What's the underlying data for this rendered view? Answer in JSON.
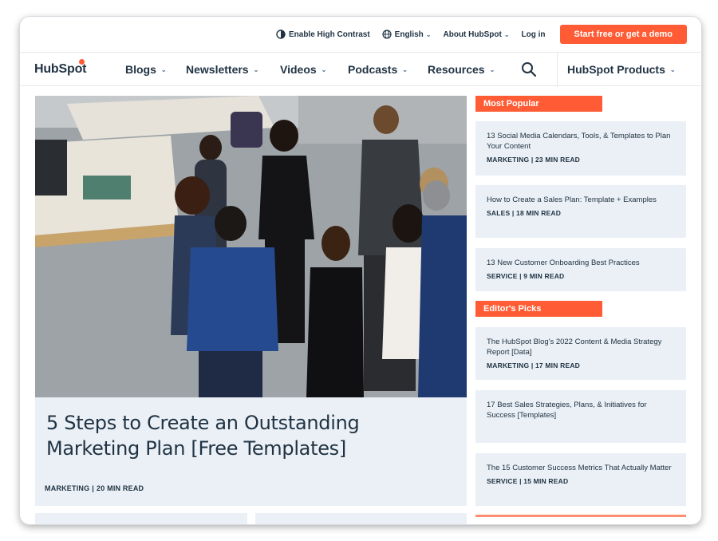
{
  "utility_bar": {
    "contrast_label": "Enable High Contrast",
    "language_label": "English",
    "about_label": "About HubSpot",
    "login_label": "Log in",
    "cta_label": "Start free or get a demo"
  },
  "logo": {
    "text_a": "HubSp",
    "text_o": "o",
    "text_b": "t"
  },
  "nav": {
    "items": [
      {
        "label": "Blogs"
      },
      {
        "label": "Newsletters"
      },
      {
        "label": "Videos"
      },
      {
        "label": "Podcasts"
      },
      {
        "label": "Resources"
      }
    ],
    "products_label": "HubSpot Products"
  },
  "hero": {
    "title": "5 Steps to Create an Outstanding Marketing Plan [Free Templates]",
    "category": "MARKETING",
    "separator": "|",
    "read_time": "20 MIN READ"
  },
  "sidebar": {
    "most_popular_label": "Most Popular",
    "editors_picks_label": "Editor's Picks",
    "most_popular": [
      {
        "title": "13 Social Media Calendars, Tools, & Templates to Plan Your Content",
        "meta": "MARKETING | 23 MIN READ"
      },
      {
        "title": "How to Create a Sales Plan: Template + Examples",
        "meta": "SALES | 18 MIN READ"
      },
      {
        "title": "13 New Customer Onboarding Best Practices",
        "meta": "SERVICE | 9 MIN READ"
      }
    ],
    "editors_picks": [
      {
        "title": "The HubSpot Blog's 2022 Content & Media Strategy Report [Data]",
        "meta": "MARKETING | 17 MIN READ"
      },
      {
        "title": "17 Best Sales Strategies, Plans, & Initiatives for Success [Templates]",
        "meta": ""
      },
      {
        "title": "The 15 Customer Success Metrics That Actually Matter",
        "meta": "SERVICE | 15 MIN READ"
      }
    ]
  },
  "colors": {
    "brand_orange": "#ff5c35",
    "navy": "#213343",
    "card_bg": "#eaf0f6"
  },
  "icons": [
    "contrast-icon",
    "globe-icon",
    "chevron-down-icon",
    "search-icon",
    "sprocket-icon"
  ]
}
